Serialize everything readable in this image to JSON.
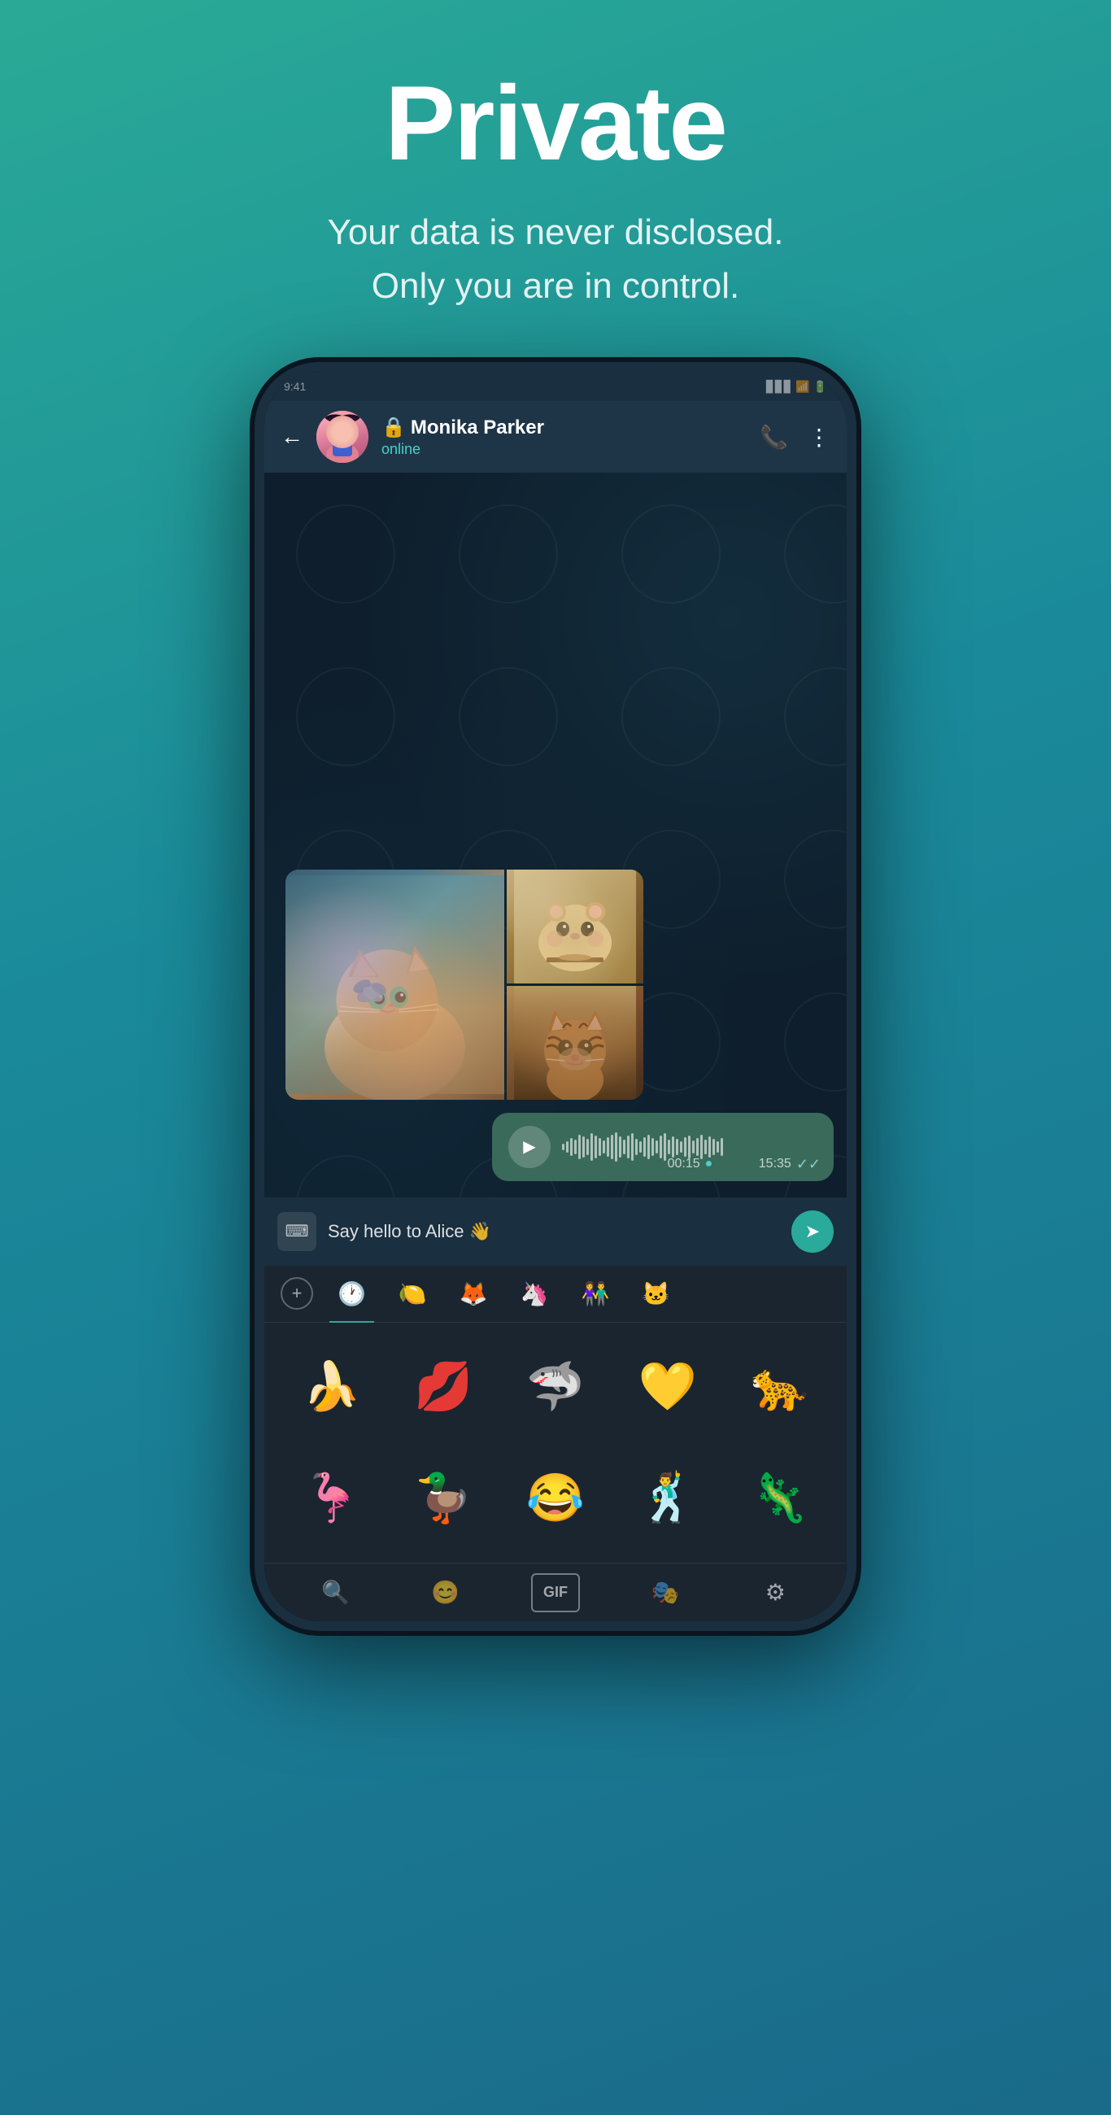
{
  "hero": {
    "title": "Private",
    "subtitle_line1": "Your data is never disclosed.",
    "subtitle_line2": "Only you are in control."
  },
  "chat": {
    "back_label": "←",
    "contact_name": "Monika Parker",
    "contact_status": "online",
    "lock_icon": "🔒",
    "voice_duration": "00:15",
    "voice_time": "15:35",
    "checkmarks": "✓✓"
  },
  "input": {
    "message_text": "Say hello to Alice 👋",
    "keyboard_icon": "⌨",
    "send_icon": "➤"
  },
  "sticker_tabs": [
    {
      "icon": "🕐",
      "active": true
    },
    {
      "icon": "🍋",
      "active": false
    },
    {
      "icon": "🦊",
      "active": false
    },
    {
      "icon": "🦄",
      "active": false
    },
    {
      "icon": "👫",
      "active": false
    },
    {
      "icon": "🐱",
      "active": false
    }
  ],
  "stickers_row1": [
    "🍌",
    "💋",
    "🦈",
    "💛",
    "🐆"
  ],
  "stickers_row2": [
    "🦩",
    "🦆",
    "😂",
    "🕺",
    "🦎"
  ],
  "bottom_bar": {
    "search_icon": "🔍",
    "emoji_icon": "😊",
    "gif_label": "GIF",
    "sticker_icon": "🎭",
    "settings_icon": "⚙"
  },
  "wave_bars": [
    8,
    14,
    22,
    18,
    30,
    26,
    20,
    34,
    28,
    22,
    16,
    24,
    30,
    36,
    26,
    18,
    28,
    34,
    20,
    14,
    24,
    30,
    22,
    16,
    28,
    34,
    18,
    26,
    20,
    14,
    24,
    28,
    16,
    22,
    30,
    18,
    26,
    20,
    14,
    22
  ]
}
